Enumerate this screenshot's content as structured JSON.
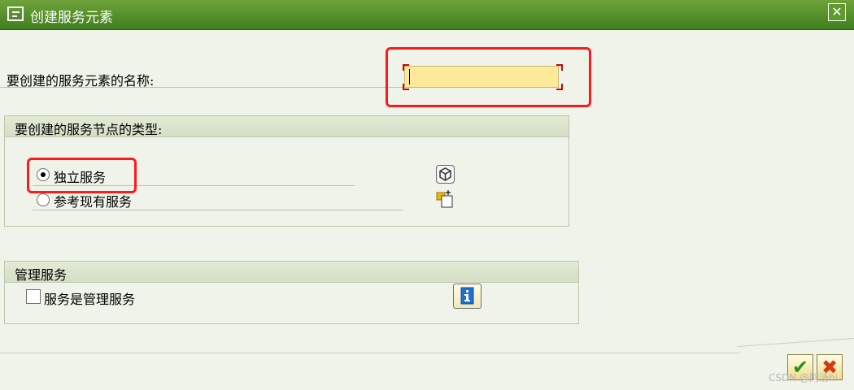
{
  "window": {
    "title": "创建服务元素",
    "icons": {
      "title": "form-icon",
      "close": "close-icon"
    }
  },
  "name_field": {
    "label": "要创建的服务元素的名称:",
    "value": ""
  },
  "type_group": {
    "title": "要创建的服务节点的类型:",
    "options": [
      {
        "label": "独立服务",
        "selected": true,
        "icon": "cube-icon"
      },
      {
        "label": "参考现有服务",
        "selected": false,
        "icon": "copy-folder-icon"
      }
    ]
  },
  "management_group": {
    "title": "管理服务",
    "checkbox_label": "服务是管理服务",
    "checked": false,
    "info_icon": "info-icon"
  },
  "footer": {
    "ok_icon": "check-icon",
    "cancel_icon": "x-icon",
    "watermark": "CSDN @阿汤hi"
  },
  "colors": {
    "titlebar": "#4f8f28",
    "background": "#eff3e9",
    "input_fill": "#fde99a",
    "highlight": "#ff1a1a"
  }
}
